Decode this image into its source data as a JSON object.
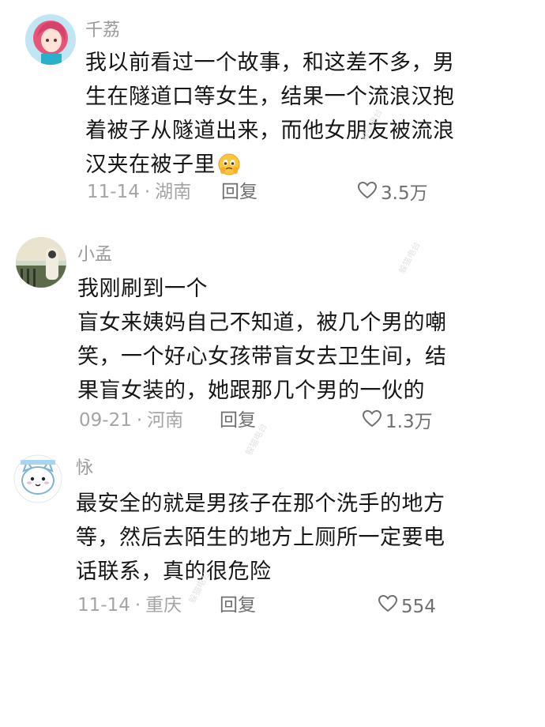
{
  "comments": [
    {
      "username": "千荔",
      "lines": [
        "我以前看过一个故事，和这差不多，男",
        "生在隧道口等女生，结果一个流浪汉抱",
        "着被子从隧道出来，而他女朋友被流浪",
        "汉夹在被子里"
      ],
      "emoji": "crying-face",
      "date": "11-14",
      "location": "湖南",
      "reply_label": "回复",
      "likes": "3.5万"
    },
    {
      "username": "小孟",
      "lines": [
        "我刚刷到一个",
        "盲女来姨妈自己不知道，被几个男的嘲",
        "笑，一个好心女孩带盲女去卫生间，结",
        "果盲女装的，她跟那几个男的一伙的"
      ],
      "date": "09-21",
      "location": "河南",
      "reply_label": "回复",
      "likes": "1.3万"
    },
    {
      "username": "怺",
      "lines": [
        "最安全的就是男孩子在那个洗手的地方",
        "等，然后去陌生的地方上厕所一定要电",
        "话联系，真的很危险"
      ],
      "date": "11-14",
      "location": "重庆",
      "reply_label": "回复",
      "likes": "554"
    }
  ],
  "separator": "·",
  "watermark": "躲猫电台"
}
